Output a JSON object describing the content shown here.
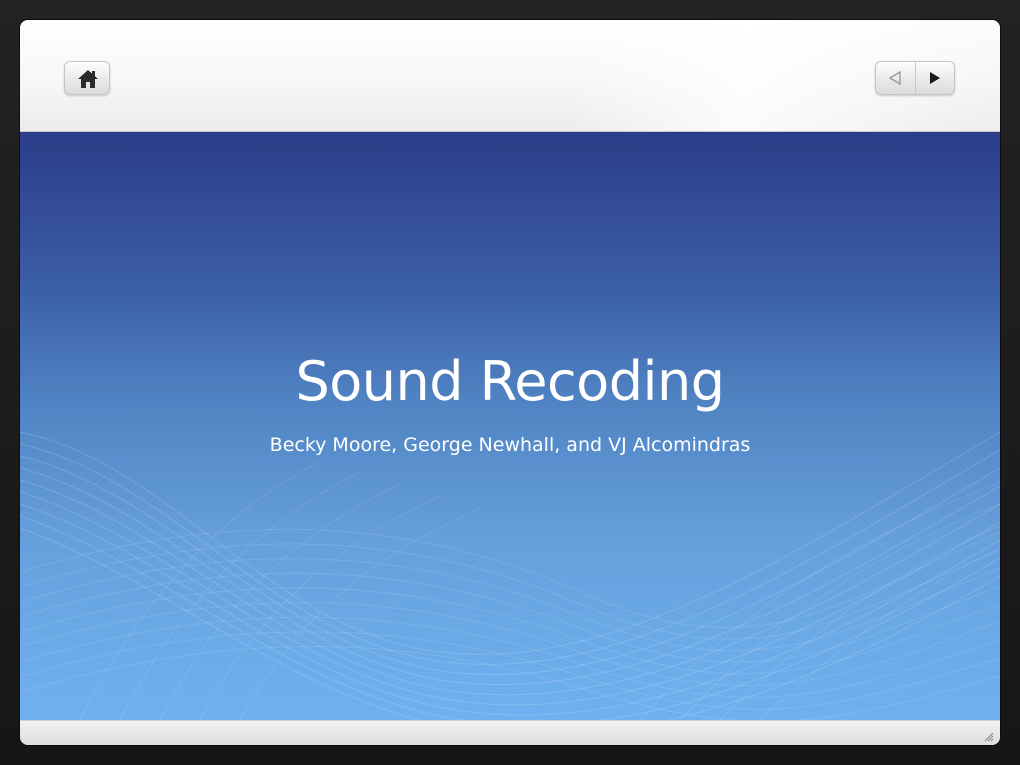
{
  "toolbar": {
    "home_icon": "home-icon",
    "prev_icon": "triangle-left-icon",
    "next_icon": "triangle-right-icon"
  },
  "slide": {
    "title": "Sound Recoding",
    "subtitle": "Becky Moore, George Newhall, and VJ Alcomindras"
  },
  "colors": {
    "slide_top": "#2b3d88",
    "slide_bottom": "#6fb1f0",
    "frame": "#1c1c1c",
    "toolbar": "#f4f4f4"
  }
}
